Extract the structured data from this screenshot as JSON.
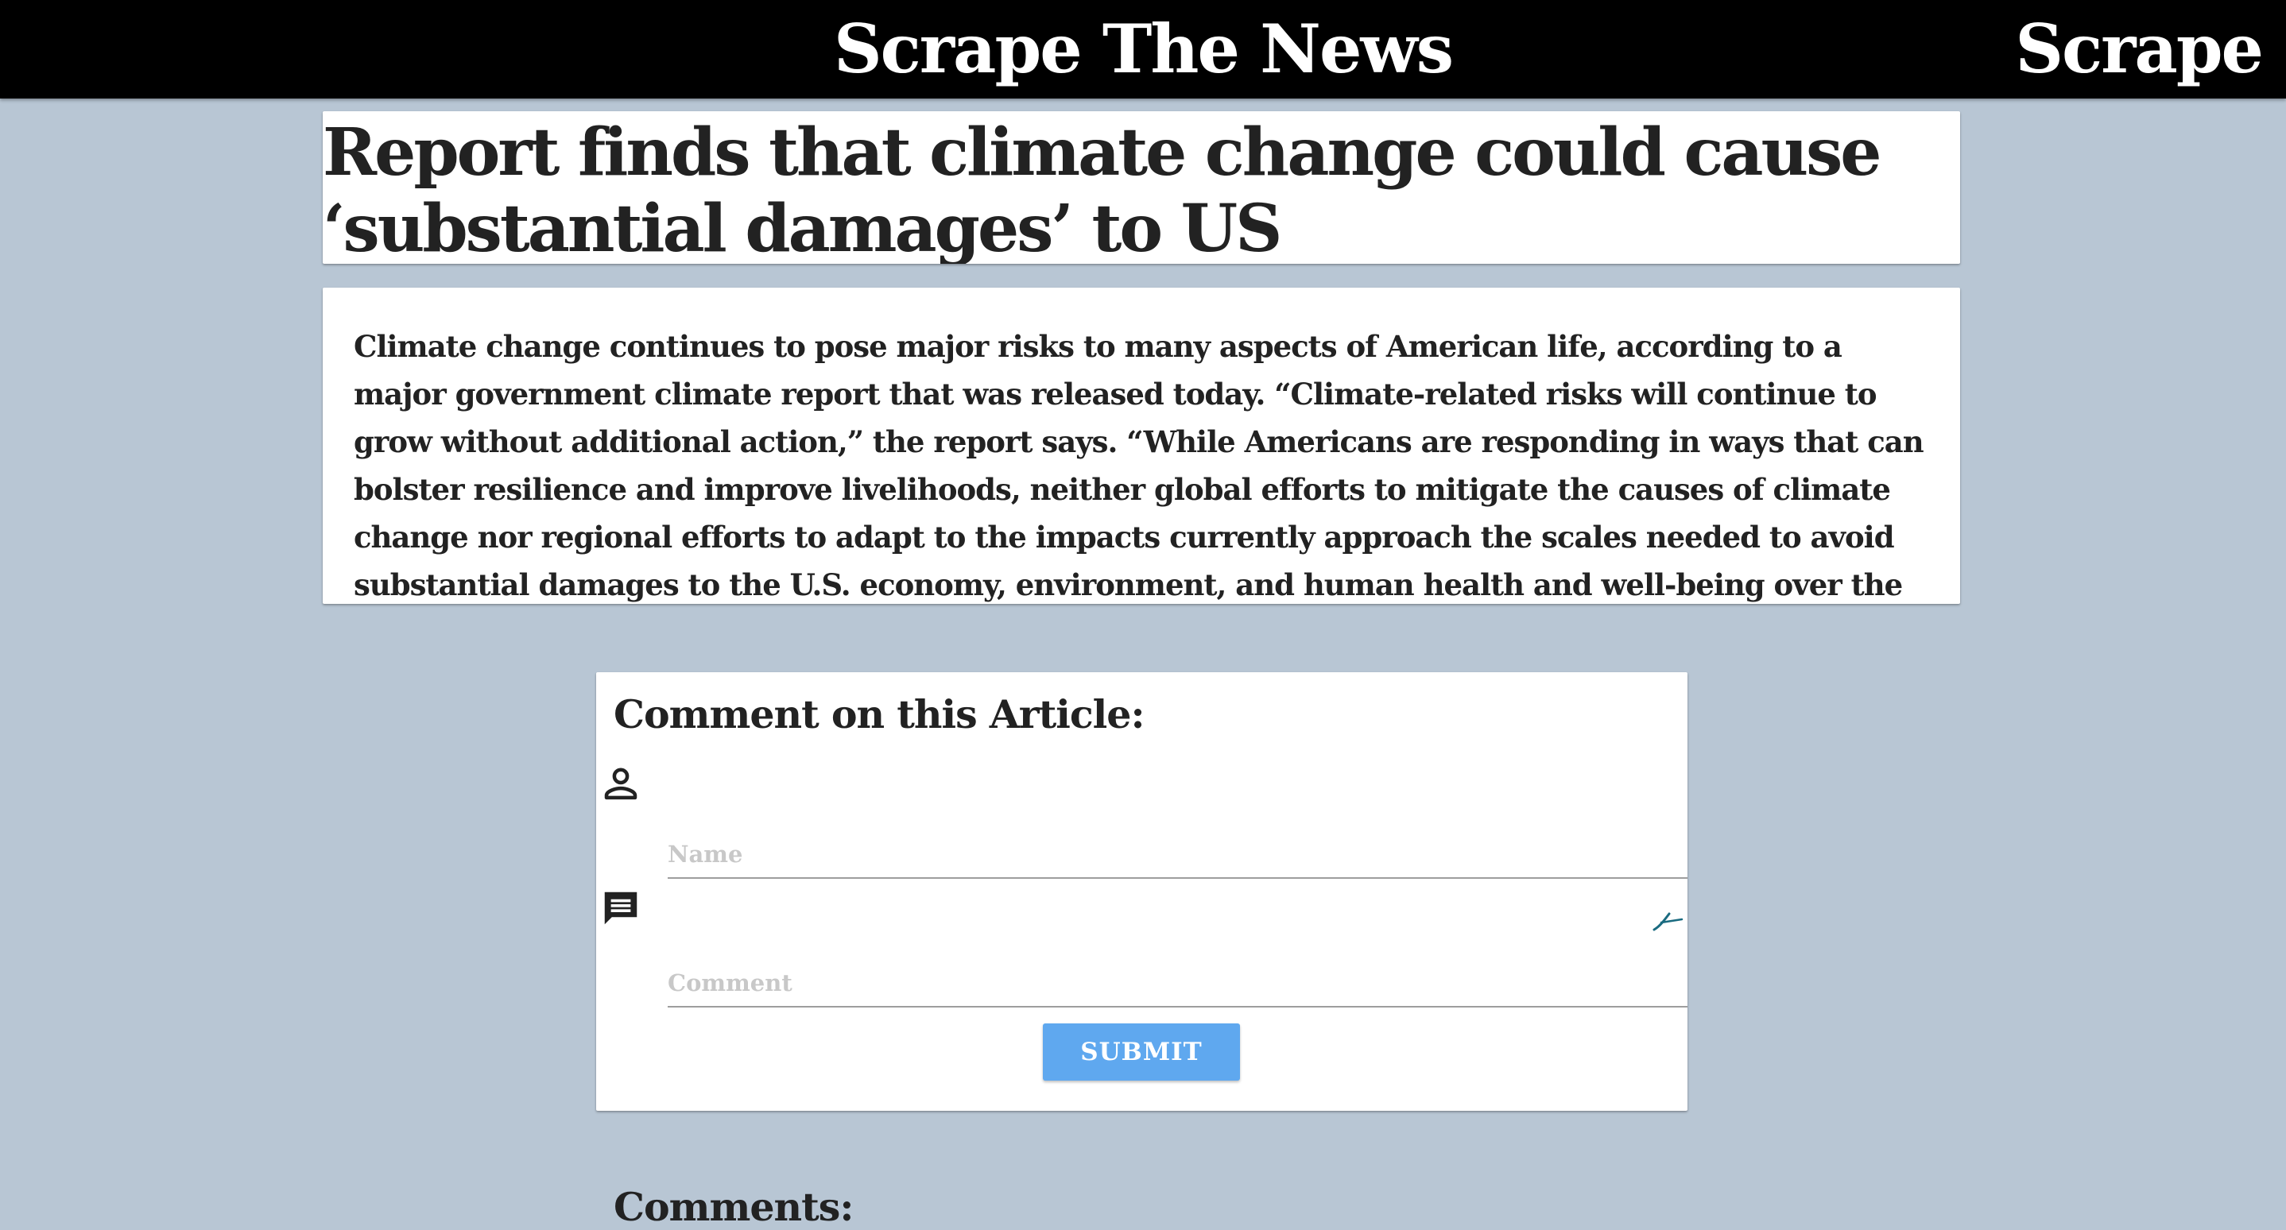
{
  "navbar": {
    "brand_center": "Scrape The News",
    "brand_right": "Scrape"
  },
  "article": {
    "headline": "Report finds that climate change could cause ‘substantial damages’ to US",
    "body": "Climate change continues to pose major risks to many aspects of American life, according to a major government climate report that was released today. “Climate-related risks will continue to grow without additional action,” the report says. “While Americans are responding in ways that can bolster resilience and improve livelihoods, neither global efforts to mitigate the causes of climate change nor regional efforts to adapt to the impacts currently approach the scales needed to avoid substantial damages to the U.S. economy, environment, and human health and well-being over the coming decades.”The report is the work of more"
  },
  "comment_form": {
    "heading": "Comment on this Article:",
    "name_placeholder": "Name",
    "name_value": "",
    "comment_placeholder": "Comment",
    "comment_value": "",
    "submit_label": "Submit",
    "icons": {
      "name": "person-icon",
      "comment": "comment-icon",
      "extension": "grammar-extension-icon"
    }
  },
  "comments": {
    "heading": "Comments:"
  },
  "colors": {
    "background": "#b8c6d4",
    "navbar": "#000000",
    "card": "#ffffff",
    "button": "#5fa8ef",
    "text": "#222222"
  }
}
